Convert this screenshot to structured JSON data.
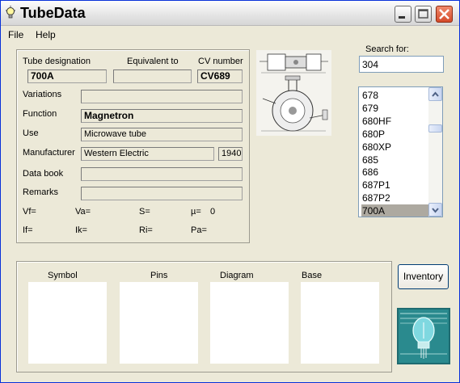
{
  "window": {
    "title": "TubeData"
  },
  "menu": {
    "file": "File",
    "help": "Help"
  },
  "details": {
    "designation_label": "Tube designation",
    "designation_value": "700A",
    "equivalent_label": "Equivalent to",
    "equivalent_value": "",
    "cv_label": "CV number",
    "cv_value": "CV689",
    "variations_label": "Variations",
    "variations_value": "",
    "function_label": "Function",
    "function_value": "Magnetron",
    "use_label": "Use",
    "use_value": "Microwave tube",
    "manufacturer_label": "Manufacturer",
    "manufacturer_value": "Western Electric",
    "year_value": "1940",
    "databook_label": "Data book",
    "databook_value": "",
    "remarks_label": "Remarks",
    "remarks_value": ""
  },
  "params": {
    "vf": "Vf=",
    "va": "Va=",
    "s": "S=",
    "mu": "µ=",
    "mu_value": "0",
    "if": "If=",
    "ik": "Ik=",
    "ri": "Ri=",
    "pa": "Pa="
  },
  "search": {
    "label": "Search for:",
    "value": "304"
  },
  "list": {
    "items": [
      "678",
      "679",
      "680HF",
      "680P",
      "680XP",
      "685",
      "686",
      "687P1",
      "687P2",
      "700A"
    ],
    "selected": "700A"
  },
  "bottom": {
    "symbol": "Symbol",
    "pins": "Pins",
    "diagram": "Diagram",
    "base": "Base"
  },
  "inventory_button": "Inventory",
  "colors": {
    "title_text": "#000000",
    "selected_row": "#ada9a0",
    "field_bg": "#ece9d8",
    "window_bg": "#ece9d8",
    "close_button": "#d54a2a"
  }
}
